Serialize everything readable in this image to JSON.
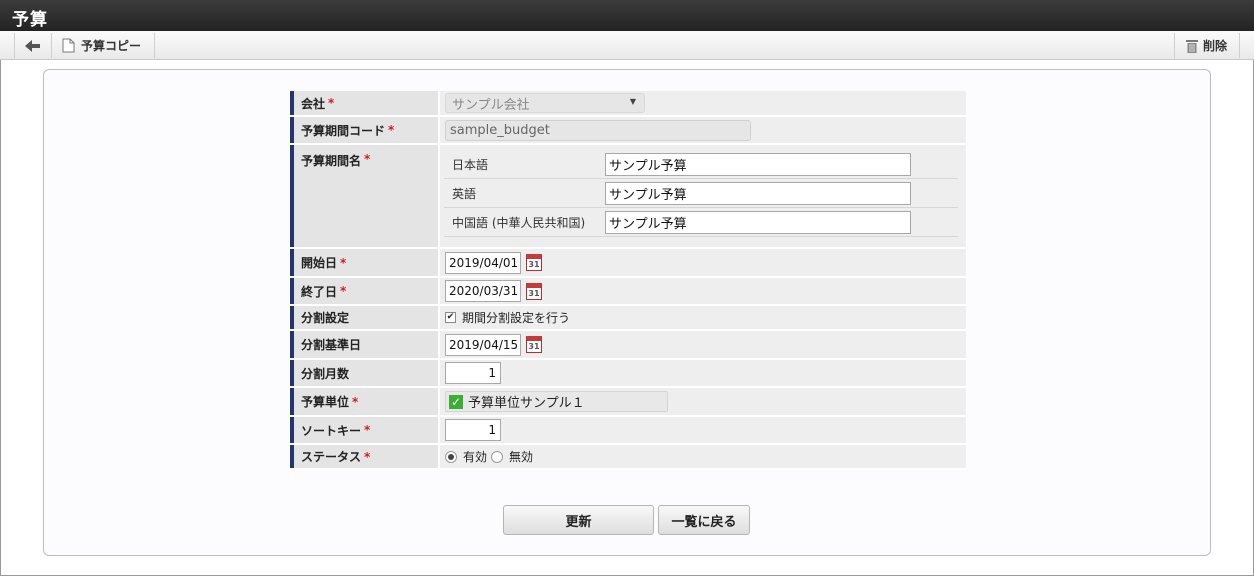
{
  "window": {
    "title": "予算"
  },
  "toolbar": {
    "back_icon": "arrow-left-icon",
    "copy_icon": "document-icon",
    "copy_label": "予算コピー",
    "delete_icon": "trash-icon",
    "delete_label": "削除"
  },
  "form": {
    "company": {
      "label": "会社",
      "required": "*",
      "value": "サンプル会社"
    },
    "period_code": {
      "label": "予算期間コード",
      "required": "*",
      "value": "sample_budget"
    },
    "period_name": {
      "label": "予算期間名",
      "required": "*",
      "languages": [
        {
          "name": "日本語",
          "value": "サンプル予算"
        },
        {
          "name": "英語",
          "value": "サンプル予算"
        },
        {
          "name": "中国語 (中華人民共和国)",
          "value": "サンプル予算"
        }
      ]
    },
    "start_date": {
      "label": "開始日",
      "required": "*",
      "value": "2019/04/01"
    },
    "end_date": {
      "label": "終了日",
      "required": "*",
      "value": "2020/03/31"
    },
    "split_setting": {
      "label": "分割設定",
      "checkbox_label": "期間分割設定を行う",
      "checked": true
    },
    "split_base_date": {
      "label": "分割基準日",
      "value": "2019/04/15"
    },
    "split_months": {
      "label": "分割月数",
      "value": "1"
    },
    "budget_unit": {
      "label": "予算単位",
      "required": "*",
      "value": "予算単位サンプル１"
    },
    "sort_key": {
      "label": "ソートキー",
      "required": "*",
      "value": "1"
    },
    "status": {
      "label": "ステータス",
      "required": "*",
      "options": [
        "有効",
        "無効"
      ],
      "selected": "有効"
    },
    "calendar_day": "31"
  },
  "buttons": {
    "update": "更新",
    "back_to_list": "一覧に戻る"
  }
}
